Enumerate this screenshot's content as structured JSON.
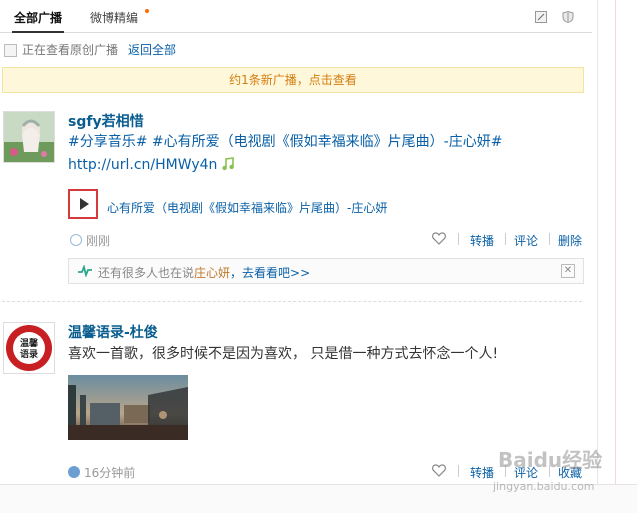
{
  "tabs": [
    {
      "label": "全部广播"
    },
    {
      "label": "微博精编"
    }
  ],
  "filter": {
    "text": "正在查看原创广播",
    "back_link": "返回全部"
  },
  "notice": {
    "text": "约1条新广播，点击查看"
  },
  "posts": [
    {
      "nick": "sgfy若相惜",
      "text_topics": "#分享音乐# #心有所爱（电视剧《假如幸福来临》片尾曲）-庄心妍#",
      "url": "http://url.cn/HMWy4n",
      "music_title": "心有所爱（电视剧《假如幸福来临》片尾曲）-庄心妍",
      "time": "刚刚",
      "actions": [
        "转播",
        "评论",
        "删除"
      ],
      "related": {
        "prefix": "还有很多人也在说",
        "name": "庄心妍",
        "suffix": "，去看看吧>>"
      }
    },
    {
      "nick": "温馨语录-杜俊",
      "text": "喜欢一首歌，很多时候不是因为喜欢， 只是借一种方式去怀念一个人!",
      "avatar_text": "温馨语录",
      "time": "16分钟前",
      "actions": [
        "转播",
        "评论",
        "收藏"
      ]
    }
  ],
  "watermark": {
    "brand": "Baidu经验",
    "url": "jingyan.baidu.com"
  },
  "colors": {
    "link": "#0a60a8",
    "notice_bg": "#fff7d9",
    "notice_text": "#d27e13",
    "highlight_box": "#d63a3a"
  }
}
